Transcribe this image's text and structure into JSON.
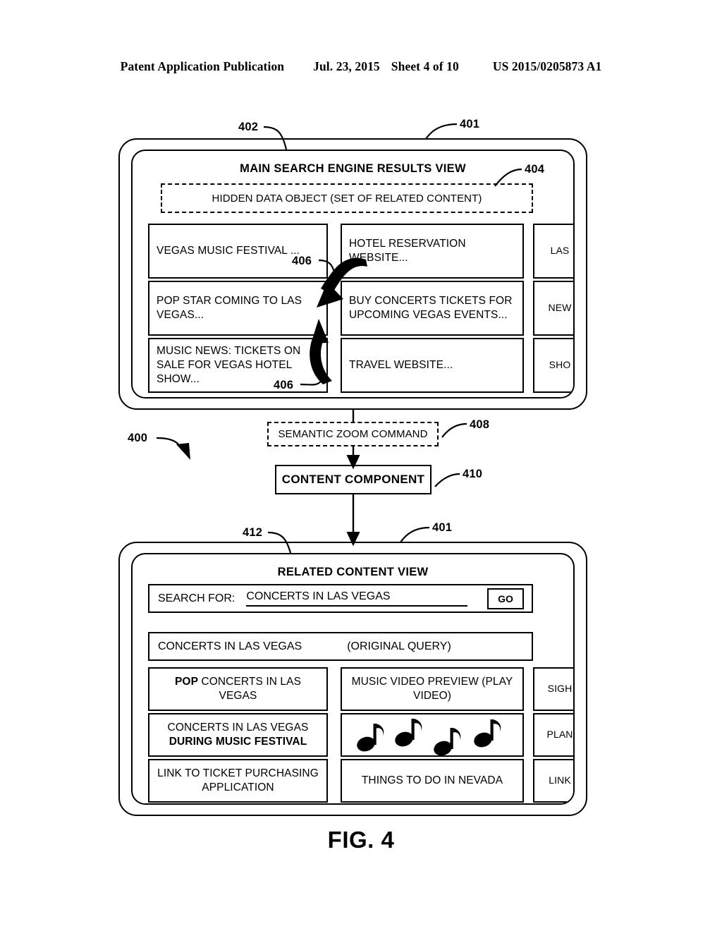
{
  "page_header": {
    "title": "Patent Application Publication",
    "date": "Jul. 23, 2015",
    "sheet": "Sheet 4 of 10",
    "publication_number": "US 2015/0205873 A1"
  },
  "figure": {
    "caption": "FIG. 4",
    "overall_ref": "400"
  },
  "main_view": {
    "device_ref": "401",
    "panel_ref": "402",
    "title": "MAIN SEARCH ENGINE RESULTS VIEW",
    "hidden_object": {
      "ref": "404",
      "label": "HIDDEN DATA OBJECT (SET OF RELATED CONTENT)"
    },
    "arrow_refs": [
      "406",
      "406"
    ],
    "results": {
      "column_1": [
        "VEGAS MUSIC FESTIVAL ...",
        "POP STAR COMING TO LAS VEGAS...",
        "MUSIC NEWS: TICKETS ON SALE FOR VEGAS HOTEL SHOW..."
      ],
      "column_2": [
        "HOTEL RESERVATION WEBSITE...",
        "BUY CONCERTS TICKETS FOR UPCOMING VEGAS EVENTS...",
        "TRAVEL WEBSITE..."
      ],
      "column_3": [
        "LAS",
        "NEW",
        "SHO"
      ]
    }
  },
  "flow": {
    "semantic_zoom": {
      "ref": "408",
      "label": "SEMANTIC ZOOM COMMAND"
    },
    "content_component": {
      "ref": "410",
      "label": "CONTENT COMPONENT"
    }
  },
  "related_view": {
    "device_ref": "401",
    "panel_ref": "412",
    "title": "RELATED CONTENT VIEW",
    "search": {
      "label": "SEARCH FOR:",
      "value": "CONCERTS IN LAS VEGAS",
      "button": "GO"
    },
    "original_query": {
      "text": "CONCERTS IN LAS VEGAS",
      "note": "(ORIGINAL QUERY)"
    },
    "results": {
      "column_1": [
        {
          "bold_prefix": "POP",
          "rest": " CONCERTS IN LAS VEGAS"
        },
        {
          "plain": "CONCERTS IN LAS VEGAS ",
          "bold_suffix": "DURING MUSIC FESTIVAL"
        },
        {
          "plain": "LINK TO TICKET PURCHASING APPLICATION"
        }
      ],
      "column_2": [
        "MUSIC VIDEO PREVIEW (PLAY VIDEO)",
        "music-notes-graphic",
        "THINGS TO DO IN NEVADA"
      ],
      "column_3": [
        "SIGH",
        "PLAN",
        "LINK"
      ]
    }
  }
}
